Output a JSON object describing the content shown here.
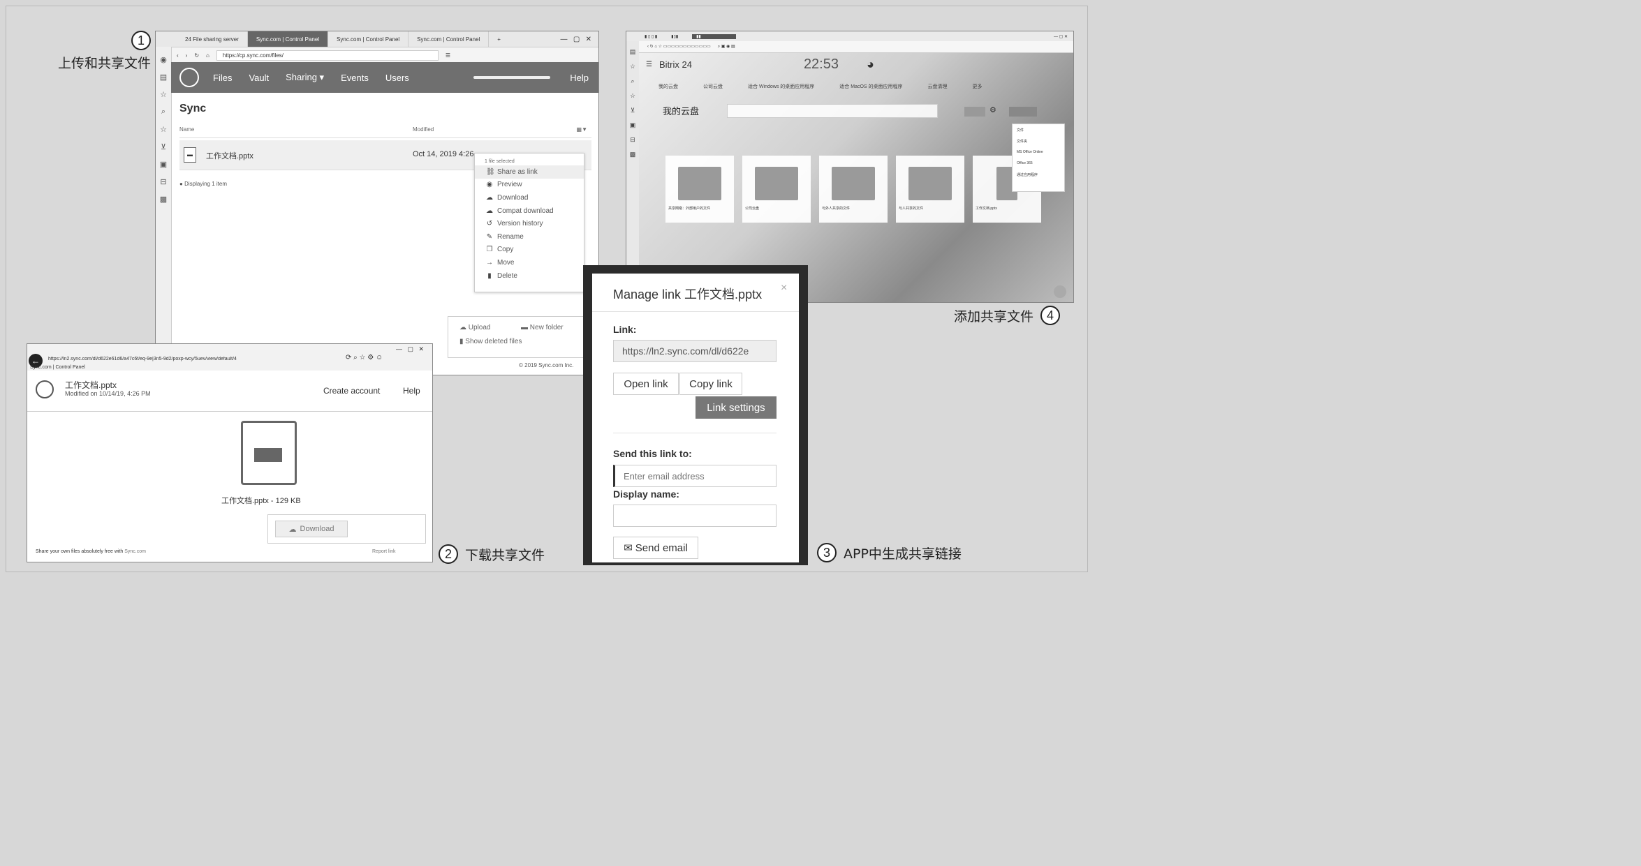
{
  "labels": {
    "step1": {
      "num": "1",
      "text": "上传和共享文件"
    },
    "step2": {
      "num": "2",
      "text": "下载共享文件"
    },
    "step3": {
      "num": "3",
      "text": "APP中生成共享链接"
    },
    "step4": {
      "num": "4",
      "text": "添加共享文件"
    }
  },
  "win1": {
    "tabs": [
      "24 File sharing server",
      "Sync.com | Control Panel",
      "Sync.com | Control Panel",
      "Sync.com | Control Panel",
      "+"
    ],
    "url": "https://cp.sync.com/files/",
    "nav": [
      "Files",
      "Vault",
      "Sharing ▾",
      "Events",
      "Users"
    ],
    "help": "Help",
    "title": "Sync",
    "col_name": "Name",
    "col_modified": "Modified",
    "file_name": "工作文档.pptx",
    "file_date": "Oct 14, 2019 4:26",
    "footer": "Displaying 1 item",
    "menu_header": "1 file selected",
    "menu": [
      "Share as link",
      "Preview",
      "Download",
      "Compat download",
      "Version history",
      "Rename",
      "Copy",
      "Move",
      "Delete"
    ],
    "upload": "Upload",
    "new_folder": "New folder",
    "show_deleted": "Show deleted files",
    "copyright": "© 2019 Sync.com Inc."
  },
  "win2": {
    "url": "https://ln2.sync.com/dl/d622e61d6/a47c6f/eq-9e|3n5-9d2/poxp-wcy/5uev/view/default/4",
    "tab": "Sync.com | Control Panel",
    "file_title": "工作文档.pptx",
    "modified": "Modified on 10/14/19, 4:26 PM",
    "create_account": "Create account",
    "help": "Help",
    "file_caption": "工作文档.pptx - 129 KB",
    "download": "Download",
    "share_text": "Share your own files absolutely free with",
    "share_link": "Sync.com",
    "report": "Report link"
  },
  "win4": {
    "brand": "Bitrix 24",
    "clock": "22:53",
    "title": "我的云盘",
    "tabs": [
      "我的云盘",
      "公司云盘",
      "适合 Windows 的桌面应用程序",
      "适合 MacOS 的桌面应用程序",
      "云盘清理",
      "更多"
    ],
    "folders": [
      "共享网络：外部用户的文件",
      "公司云盘",
      "与外人共享的文件",
      "与人共享的文件",
      "工作文档.pptx"
    ],
    "menu": [
      "文件",
      "文件夹",
      "MS Office Online",
      "Office 365",
      "通过应用程序"
    ]
  },
  "dialog": {
    "title": "Manage link 工作文档.pptx",
    "link_label": "Link:",
    "link_value": "https://ln2.sync.com/dl/d622e",
    "open_link": "Open link",
    "copy_link": "Copy link",
    "link_settings": "Link settings",
    "send_label": "Send this link to:",
    "email_placeholder": "Enter email address",
    "display_label": "Display name:",
    "send_email": "Send email"
  }
}
